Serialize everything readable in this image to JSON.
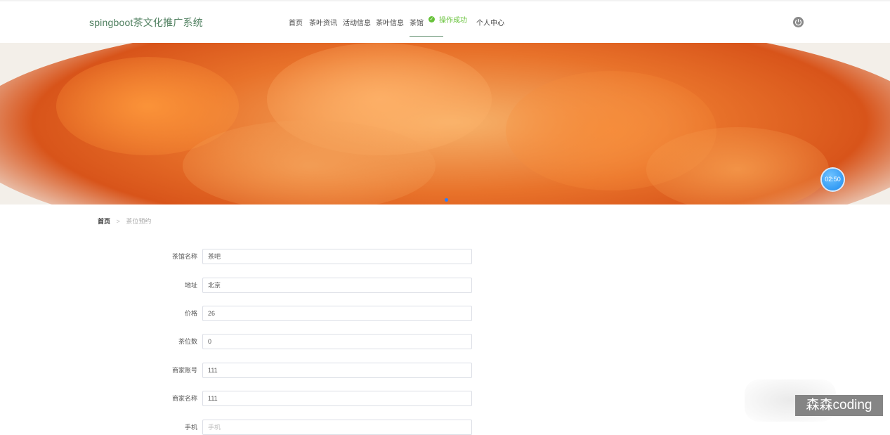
{
  "header": {
    "logo": "spingboot茶文化推广系统",
    "nav": [
      "首页",
      "茶叶资讯",
      "活动信息",
      "茶叶信息",
      "茶馆",
      "个人中心"
    ],
    "toast": "操作成功"
  },
  "banner": {
    "timer": "02:50"
  },
  "breadcrumb": {
    "home": "首页",
    "separator": ">",
    "current": "茶位预约"
  },
  "form": {
    "fields": [
      {
        "label": "茶馆名称",
        "value": "茶吧"
      },
      {
        "label": "地址",
        "value": "北京"
      },
      {
        "label": "价格",
        "value": "26"
      },
      {
        "label": "茶位数",
        "value": "0"
      },
      {
        "label": "商家账号",
        "value": "111"
      },
      {
        "label": "商家名称",
        "value": "111"
      },
      {
        "label": "手机",
        "placeholder": "手机"
      }
    ]
  },
  "watermark": "森森coding"
}
